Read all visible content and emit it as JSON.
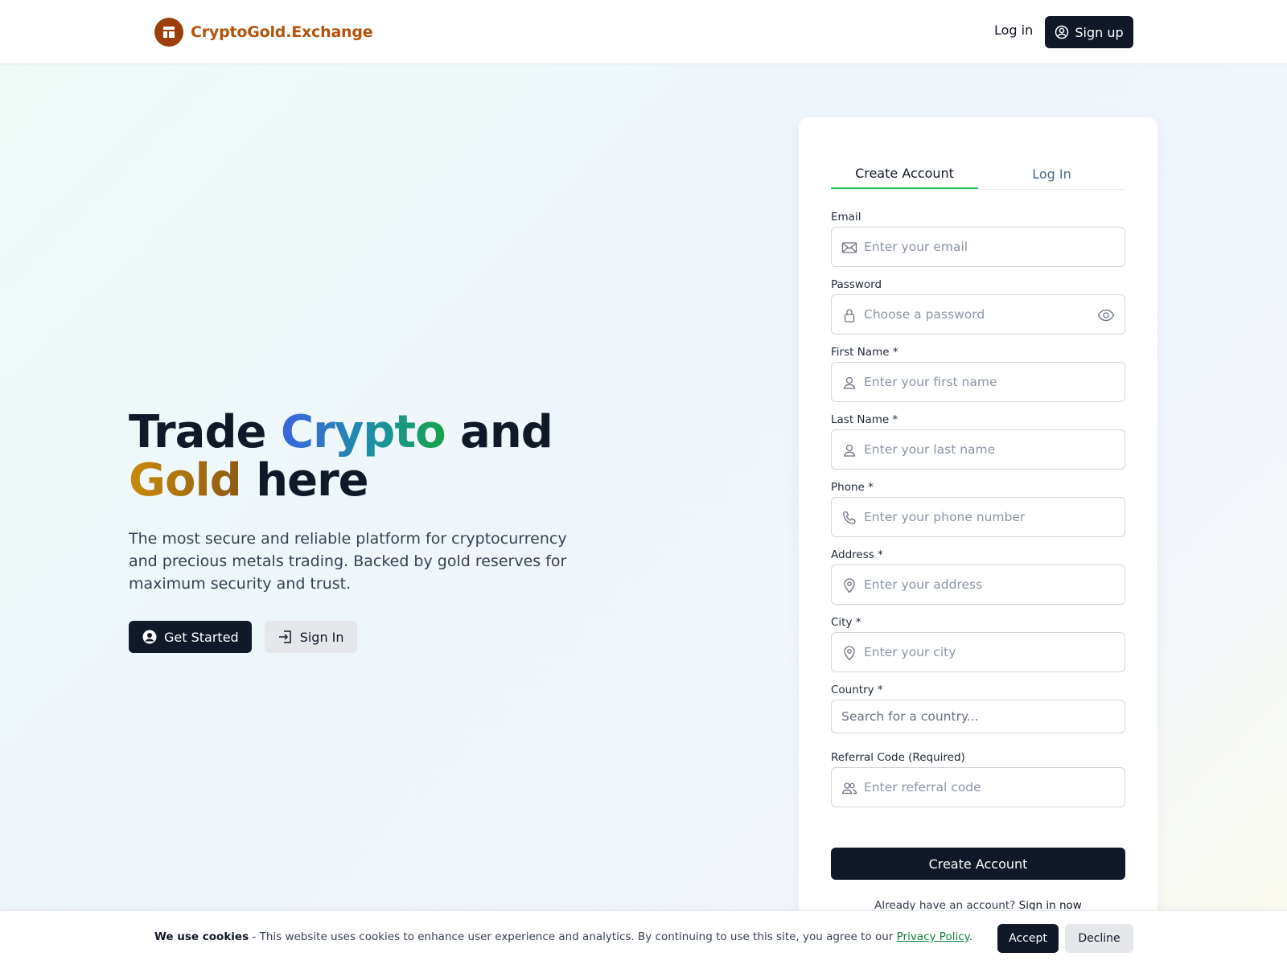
{
  "header": {
    "brand_name": "CryptoGold.Exchange",
    "login_label": "Log in",
    "signup_label": "Sign up"
  },
  "hero": {
    "title_part1": "Trade ",
    "title_highlight1": "Crypto",
    "title_part2": " and",
    "title_highlight2": "Gold",
    "title_part3": " here",
    "subtitle": "The most secure and reliable platform for cryptocurrency and precious metals trading. Backed by gold reserves for maximum security and trust.",
    "get_started_label": "Get Started",
    "sign_in_label": "Sign In"
  },
  "form": {
    "tabs": [
      {
        "label": "Create Account",
        "active": true
      },
      {
        "label": "Log In",
        "active": false
      }
    ],
    "fields": {
      "email": {
        "label": "Email",
        "placeholder": "Enter your email",
        "value": "",
        "icon": "mail-icon"
      },
      "password": {
        "label": "Password",
        "placeholder": "Choose a password",
        "value": "",
        "icon": "lock-icon"
      },
      "first_name": {
        "label": "First Name *",
        "placeholder": "Enter your first name",
        "value": "",
        "icon": "user-icon"
      },
      "last_name": {
        "label": "Last Name *",
        "placeholder": "Enter your last name",
        "value": "",
        "icon": "user-icon"
      },
      "phone": {
        "label": "Phone *",
        "placeholder": "Enter your phone number",
        "value": "",
        "icon": "phone-icon"
      },
      "address": {
        "label": "Address *",
        "placeholder": "Enter your address",
        "value": "",
        "icon": "map-pin-icon"
      },
      "city": {
        "label": "City *",
        "placeholder": "Enter your city",
        "value": "",
        "icon": "map-pin-icon"
      },
      "country": {
        "label": "Country *",
        "placeholder": "Search for a country...",
        "value": ""
      },
      "referral": {
        "label": "Referral Code (Required)",
        "placeholder": "Enter referral code",
        "value": "",
        "icon": "users-icon"
      }
    },
    "submit_label": "Create Account",
    "already_text": "Already have an account?",
    "sign_in_now": "Sign in now"
  },
  "cookie": {
    "title": "We use cookies",
    "text": " - This website uses cookies to enhance user experience and analytics. By continuing to use this site, you agree to our ",
    "policy_link": "Privacy Policy",
    "suffix": ".",
    "accept_label": "Accept",
    "decline_label": "Decline"
  },
  "colors": {
    "brand": "#b4530b",
    "dark": "#111827",
    "accent_green": "#22c55e"
  }
}
